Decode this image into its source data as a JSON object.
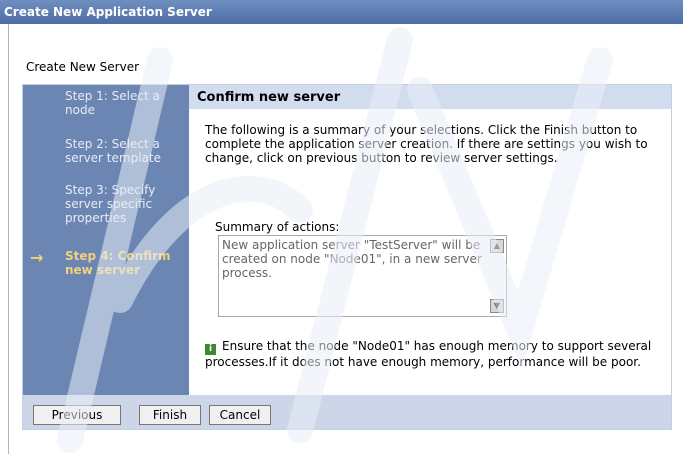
{
  "window": {
    "title": "Create New Application Server"
  },
  "page": {
    "section_title": "Create New Server"
  },
  "wizard": {
    "steps": [
      "Step 1: Select a node",
      "Step 2: Select a server template",
      "Step 3: Specify server specific properties",
      "Step 4: Confirm new server"
    ],
    "current_step_arrow": "→",
    "header": "Confirm new server",
    "description": "The following is a summary of your selections. Click the Finish button to complete the application server creation. If there are settings you wish to change, click on previous button to review server settings.",
    "summary_label": "Summary of actions:",
    "summary_text": "New application server \"TestServer\" will be created on node \"Node01\", in a new server process.",
    "info_icon": "i",
    "info_text": "Ensure that the node \"Node01\" has enough memory to support several processes.If it does not have enough memory, performance will be poor."
  },
  "buttons": {
    "previous": "Previous",
    "finish": "Finish",
    "cancel": "Cancel"
  },
  "colors": {
    "step_panel": "#6c86b4",
    "current_step": "#f0d27a",
    "header": "#d2dcef"
  }
}
